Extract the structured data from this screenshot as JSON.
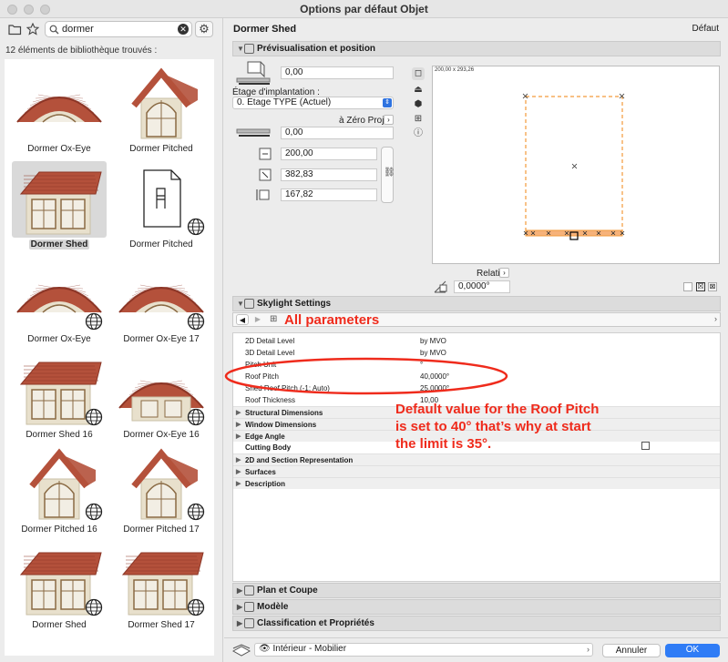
{
  "window": {
    "title": "Options par défaut Objet"
  },
  "library": {
    "search_value": "dormer",
    "found_text": "12 éléments de bibliothèque trouvés :",
    "items": [
      {
        "label": "Dormer Ox-Eye",
        "kind": "oxeye",
        "globe": false,
        "selected": false
      },
      {
        "label": "Dormer Pitched",
        "kind": "pitched",
        "globe": false,
        "selected": false
      },
      {
        "label": "Dormer Shed",
        "kind": "shed",
        "globe": false,
        "selected": true
      },
      {
        "label": "Dormer Pitched",
        "kind": "doc",
        "globe": true,
        "selected": false
      },
      {
        "label": "Dormer Ox-Eye",
        "kind": "oxeye",
        "globe": true,
        "selected": false
      },
      {
        "label": "Dormer Ox-Eye 17",
        "kind": "oxeye",
        "globe": true,
        "selected": false
      },
      {
        "label": "Dormer Shed 16",
        "kind": "shed16",
        "globe": true,
        "selected": false
      },
      {
        "label": "Dormer Ox-Eye 16",
        "kind": "oxeye16",
        "globe": true,
        "selected": false
      },
      {
        "label": "Dormer Pitched 16",
        "kind": "pitched",
        "globe": true,
        "selected": false
      },
      {
        "label": "Dormer Pitched 17",
        "kind": "pitched",
        "globe": true,
        "selected": false
      },
      {
        "label": "Dormer Shed",
        "kind": "shed",
        "globe": true,
        "selected": false
      },
      {
        "label": "Dormer Shed 17",
        "kind": "shed",
        "globe": true,
        "selected": false
      }
    ]
  },
  "object": {
    "title": "Dormer Shed",
    "default_label": "Défaut"
  },
  "preview_section": {
    "title": "Prévisualisation et position",
    "elevation_value": "0,00",
    "story_label": "Étage d'implantation :",
    "story_value": "0. Etage TYPE (Actuel)",
    "to_project_zero": "à Zéro Projet",
    "offset_value": "0,00",
    "width_value": "200,00",
    "depth_value": "382,83",
    "height_value": "167,82",
    "preview_dims": "200,00 x 293,26",
    "relative_label": "Relatif",
    "angle_value": "0,0000°"
  },
  "skylight": {
    "title": "Skylight Settings",
    "params": [
      {
        "name": "2D Detail Level",
        "value": "by MVO",
        "group": false
      },
      {
        "name": "3D Detail Level",
        "value": "by MVO",
        "group": false
      },
      {
        "name": "Pitch Unit",
        "value": "°",
        "group": false
      },
      {
        "name": "Roof Pitch",
        "value": "40,0000°",
        "group": false
      },
      {
        "name": "Shed Roof Pitch (-1: Auto)",
        "value": "25,0000°",
        "group": false
      },
      {
        "name": "Roof Thickness",
        "value": "10,00",
        "group": false
      },
      {
        "name": "Structural Dimensions",
        "value": "",
        "group": true
      },
      {
        "name": "Window Dimensions",
        "value": "",
        "group": true
      },
      {
        "name": "Edge Angle",
        "value": "",
        "group": true
      },
      {
        "name": "Cutting Body",
        "value": "",
        "group": false,
        "bold": true
      },
      {
        "name": "2D and Section Representation",
        "value": "",
        "group": true
      },
      {
        "name": "Surfaces",
        "value": "",
        "group": true
      },
      {
        "name": "Description",
        "value": "",
        "group": true
      }
    ]
  },
  "collapsed_sections": [
    "Plan et Coupe",
    "Modèle",
    "Classification et Propriétés"
  ],
  "footer": {
    "layer_value": "Intérieur - Mobilier",
    "cancel_label": "Annuler",
    "ok_label": "OK"
  },
  "annotations": {
    "all_parameters": "All parameters",
    "note_lines": [
      "Default value for the Roof Pitch",
      "is set to 40° that’s why at start",
      "the limit is 35°."
    ],
    "color": "#ef2b1c"
  }
}
